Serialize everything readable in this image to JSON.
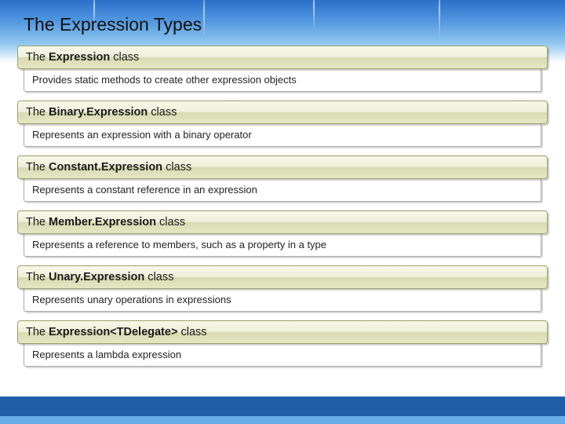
{
  "title": "The Expression Types",
  "items": [
    {
      "pre": "The ",
      "bold": "Expression",
      "post": " class",
      "desc": "Provides static methods to create other expression objects"
    },
    {
      "pre": "The ",
      "bold": "Binary.Expression",
      "post": " class",
      "desc": "Represents an expression with a binary operator"
    },
    {
      "pre": "The ",
      "bold": "Constant.Expression",
      "post": " class",
      "desc": "Represents a constant reference in an expression"
    },
    {
      "pre": "The ",
      "bold": "Member.Expression",
      "post": " class",
      "desc": "Represents a reference to members, such as a property in a type"
    },
    {
      "pre": "The ",
      "bold": "Unary.Expression",
      "post": " class",
      "desc": "Represents unary operations in expressions"
    },
    {
      "pre": "The ",
      "bold": "Expression<TDelegate>",
      "post": " class",
      "desc": "Represents a lambda expression"
    }
  ]
}
